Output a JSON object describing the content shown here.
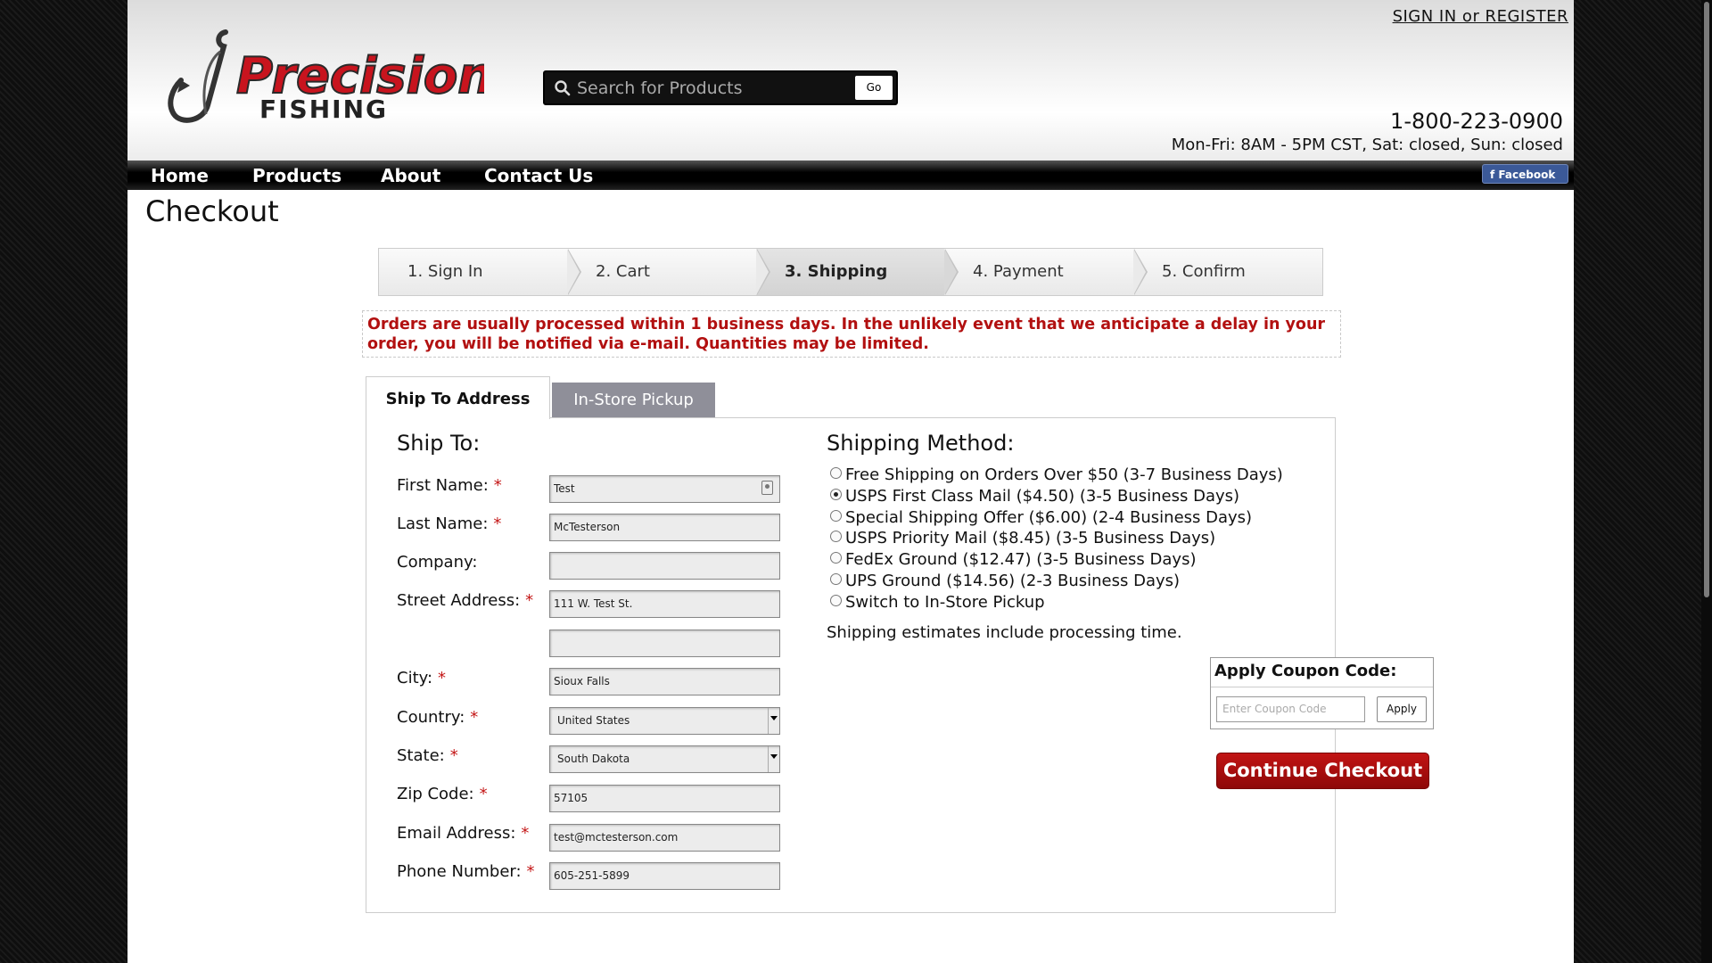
{
  "header": {
    "logo_alt": "Precision Fishing",
    "search_placeholder": "Search for Products",
    "search_button": "Go",
    "signin": "SIGN IN or REGISTER",
    "phone": "1-800-223-0900",
    "hours": "Mon-Fri: 8AM - 5PM CST, Sat: closed, Sun: closed"
  },
  "nav": {
    "items": [
      "Home",
      "Products",
      "About",
      "Contact Us"
    ],
    "facebook": "Facebook"
  },
  "page_title": "Checkout",
  "steps": [
    "1. Sign In",
    "2. Cart",
    "3. Shipping",
    "4. Payment",
    "5. Confirm"
  ],
  "active_step": 2,
  "notice": "Orders are usually processed within 1 business days. In the unlikely event that we anticipate a delay in your order, you will be notified via e-mail. Quantities may be limited.",
  "tabs": [
    "Ship To Address",
    "In-Store Pickup"
  ],
  "ship_to": {
    "heading": "Ship To:",
    "fields": [
      {
        "label": "First Name:",
        "required": true,
        "value": "Test"
      },
      {
        "label": "Last Name:",
        "required": true,
        "value": "McTesterson"
      },
      {
        "label": "Company:",
        "required": false,
        "value": ""
      },
      {
        "label": "Street Address:",
        "required": true,
        "value": "111 W. Test St."
      },
      {
        "label": "",
        "required": false,
        "value": ""
      },
      {
        "label": "City:",
        "required": true,
        "value": "Sioux Falls"
      },
      {
        "label": "Country:",
        "required": true,
        "value": "United States"
      },
      {
        "label": "State:",
        "required": true,
        "value": "South Dakota"
      },
      {
        "label": "Zip Code:",
        "required": true,
        "value": "57105"
      },
      {
        "label": "Email Address:",
        "required": true,
        "value": "test@mctesterson.com"
      },
      {
        "label": "Phone Number:",
        "required": true,
        "value": "605-251-5899"
      }
    ],
    "required_mark": "*"
  },
  "shipping": {
    "heading": "Shipping Method:",
    "options": [
      "Free Shipping on Orders Over $50 (3-7 Business Days)",
      "USPS First Class Mail ($4.50) (3-5 Business Days)",
      "Special Shipping Offer ($6.00) (2-4 Business Days)",
      "USPS Priority Mail ($8.45) (3-5 Business Days)",
      "FedEx Ground ($12.47) (3-5 Business Days)",
      "UPS Ground ($14.56) (2-3 Business Days)",
      "Switch to In-Store Pickup"
    ],
    "selected_index": 1,
    "estimate_note": "Shipping estimates include processing time."
  },
  "coupon": {
    "title": "Apply Coupon Code:",
    "placeholder": "Enter Coupon Code",
    "button": "Apply"
  },
  "continue_button": "Continue Checkout",
  "colors": {
    "brand_red": "#b21010",
    "button_red": "#a50c0c",
    "tab_inactive": "#8f8f99",
    "facebook": "#3b5998"
  }
}
